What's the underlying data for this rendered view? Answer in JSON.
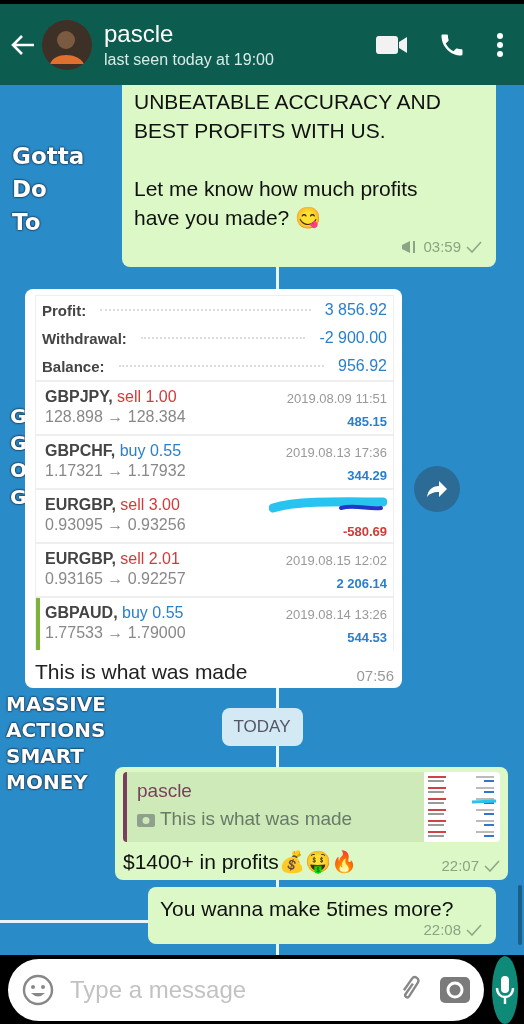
{
  "header": {
    "name": "pascle",
    "status": "last seen today at 19:00"
  },
  "wallpaper": [
    {
      "text": "Gotta",
      "kind": "top"
    },
    {
      "text": "Do",
      "kind": "top"
    },
    {
      "text": "To",
      "kind": "top"
    },
    {
      "text": "G",
      "kind": "middle"
    },
    {
      "text": "G",
      "kind": "middle"
    },
    {
      "text": "O",
      "kind": "middle"
    },
    {
      "text": "G",
      "kind": "middle"
    },
    {
      "text": "MASSIVE",
      "kind": "bottom"
    },
    {
      "text": "ACTIONS",
      "kind": "bottom"
    },
    {
      "text": "SMART",
      "kind": "bottom"
    },
    {
      "text": "MONEY",
      "kind": "bottom"
    }
  ],
  "messages": [
    {
      "kind": "text",
      "text": "UNBEATABLE ACCURACY AND\nBEST PROFITS WITH US.\n\nLet me know how much profits\nhave you made? 😋",
      "time": "03:59",
      "broadcast": true,
      "cut_top": true
    },
    {
      "kind": "image",
      "caption": "This is what was made",
      "time": "07:56",
      "summary": [
        {
          "label": "Profit:",
          "value": "3 856.92"
        },
        {
          "label": "Withdrawal:",
          "value": "-2 900.00"
        },
        {
          "label": "Balance:",
          "value": "956.92"
        }
      ],
      "trades": [
        {
          "symbol": "GBPJPY,",
          "side": "sell",
          "volume": "1.00",
          "prices": "128.898 → 128.384",
          "time": "2019.08.09 11:51",
          "profit": "485.15",
          "loss": false,
          "highlighted": false
        },
        {
          "symbol": "GBPCHF,",
          "side": "buy",
          "volume": "0.55",
          "prices": "1.17321 → 1.17932",
          "time": "2019.08.13 17:36",
          "profit": "344.29",
          "loss": false,
          "highlighted": false
        },
        {
          "symbol": "EURGBP,",
          "side": "sell",
          "volume": "3.00",
          "prices": "0.93095 → 0.93256",
          "profit": "-580.69",
          "loss": true,
          "highlighted": false
        },
        {
          "symbol": "EURGBP,",
          "side": "sell",
          "volume": "2.01",
          "prices": "0.93165 → 0.92257",
          "time": "2019.08.15 12:02",
          "profit": "2 206.14",
          "loss": false,
          "highlighted": false
        },
        {
          "symbol": "GBPAUD,",
          "side": "buy",
          "volume": "0.55",
          "prices": "1.77533 → 1.79000",
          "time": "2019.08.14 13:26",
          "profit": "544.53",
          "loss": false,
          "highlighted": true
        }
      ]
    },
    {
      "kind": "date",
      "text": "TODAY"
    },
    {
      "kind": "quote",
      "quote_name": "pascle",
      "quote_text": "This is what was made",
      "text": "$1400+ in profits💰🤑🔥",
      "time": "22:07"
    },
    {
      "kind": "text",
      "text": "You wanna make 5times more?",
      "time": "22:08",
      "broadcast": false,
      "cut_top": false
    }
  ],
  "composer": {
    "placeholder": "Type a message"
  }
}
